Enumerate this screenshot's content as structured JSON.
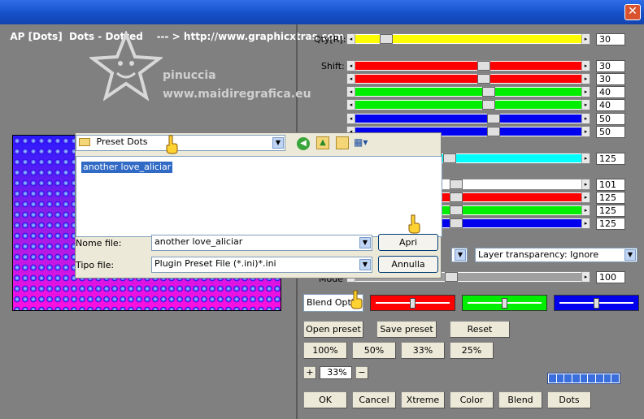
{
  "window": {
    "title": "AP [Dots]  Dots - Dotted    --- > http://www.graphicxtras.com",
    "close": "✕"
  },
  "logo": {
    "line1": "pinuccia",
    "line2": "www.maidiregrafica.eu"
  },
  "sliders": {
    "qty": {
      "label": "Qty[R]:",
      "value": "30"
    },
    "shift_label": "Shift:",
    "values": [
      "30",
      "30",
      "40",
      "40",
      "50",
      "50",
      "125",
      "101",
      "125",
      "125",
      "125",
      "100"
    ]
  },
  "dialog": {
    "folder": "Preset Dots",
    "item": "another love_aliciar",
    "filename_label": "Nome file:",
    "filename": "another love_aliciar",
    "filetype_label": "Tipo file:",
    "filetype": "Plugin Preset File (*.ini)*.ini",
    "open": "Apri",
    "cancel": "Annulla"
  },
  "transparency": "Layer transparency: Ignore",
  "mode_label": "Mode",
  "blend_options": "Blend Optio",
  "buttons": {
    "open_preset": "Open preset",
    "save_preset": "Save preset",
    "reset": "Reset",
    "p100": "100%",
    "p50": "50%",
    "p33": "33%",
    "p25": "25%",
    "plus": "+",
    "zoom": "33%",
    "minus": "−",
    "ok": "OK",
    "cancel": "Cancel",
    "xtreme": "Xtreme",
    "color": "Color",
    "blend": "Blend",
    "dots": "Dots"
  },
  "colors": {
    "yellow": "#ffff00",
    "red": "#ff0000",
    "green": "#00ee00",
    "blue": "#0000ee",
    "cyan": "#00ffff",
    "white": "#ffffff",
    "gray": "#a0a0a0"
  },
  "progress": {
    "percent": 100
  }
}
